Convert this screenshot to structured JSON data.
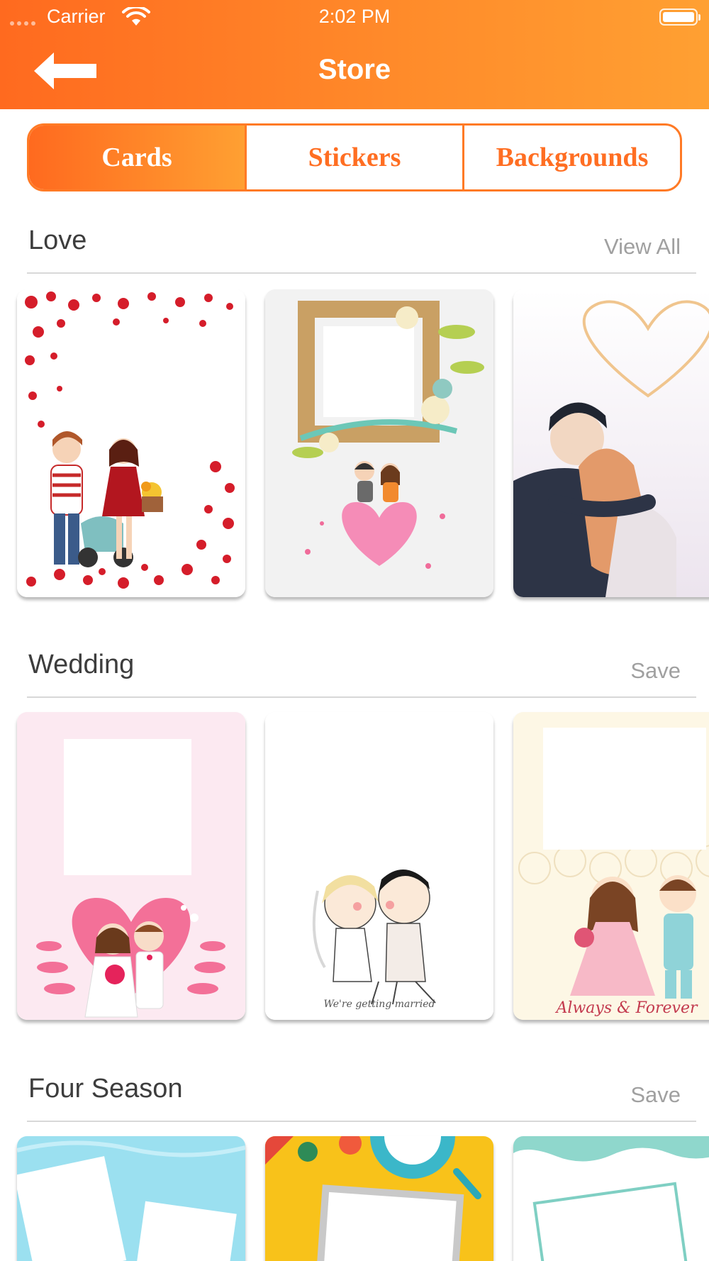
{
  "status_bar": {
    "carrier": "Carrier",
    "time": "2:02 PM"
  },
  "nav": {
    "title": "Store"
  },
  "tabs": [
    {
      "label": "Cards",
      "active": true
    },
    {
      "label": "Stickers",
      "active": false
    },
    {
      "label": "Backgrounds",
      "active": false
    }
  ],
  "sections": [
    {
      "title": "Love",
      "action": "View All"
    },
    {
      "title": "Wedding",
      "action": "Save"
    },
    {
      "title": "Four Season",
      "action": "Save"
    }
  ],
  "cards": {
    "wedding_2_caption": "We're getting married",
    "wedding_3_caption": "Always & Forever"
  },
  "colors": {
    "accent_start": "#ff6a1f",
    "accent_end": "#ffa032",
    "section_action": "#a0a0a0"
  }
}
